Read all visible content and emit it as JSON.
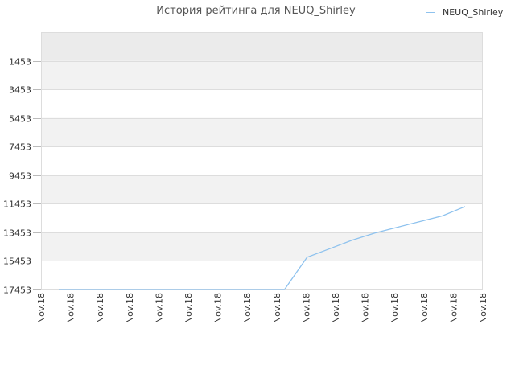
{
  "chart_data": {
    "type": "line",
    "title": "История рейтинга для NEUQ_Shirley",
    "xlabel": "",
    "ylabel": "",
    "y_axis_inverted": true,
    "ylim": [
      -547,
      17453
    ],
    "y_ticks": [
      1453,
      3453,
      5453,
      7453,
      9453,
      11453,
      13453,
      15453,
      17453
    ],
    "x_tick_labels": [
      "Nov.18",
      "Nov.18",
      "Nov.18",
      "Nov.18",
      "Nov.18",
      "Nov.18",
      "Nov.18",
      "Nov.18",
      "Nov.18",
      "Nov.18",
      "Nov.18",
      "Nov.18",
      "Nov.18",
      "Nov.18",
      "Nov.18",
      "Nov.18"
    ],
    "grid": true,
    "legend_position": "top-right",
    "colors": {
      "line": "#8ec2ee",
      "band_shaded": "#f2f2f2",
      "band_top": "#ebebeb",
      "grid": "#dddddd"
    },
    "series": [
      {
        "name": "NEUQ_Shirley",
        "values": [
          17453,
          17453,
          17453,
          17453,
          17453,
          17453,
          17453,
          17453,
          17453,
          17453,
          17453,
          15200,
          14600,
          14000,
          13500,
          13100,
          12700,
          12300,
          11650
        ]
      }
    ]
  }
}
